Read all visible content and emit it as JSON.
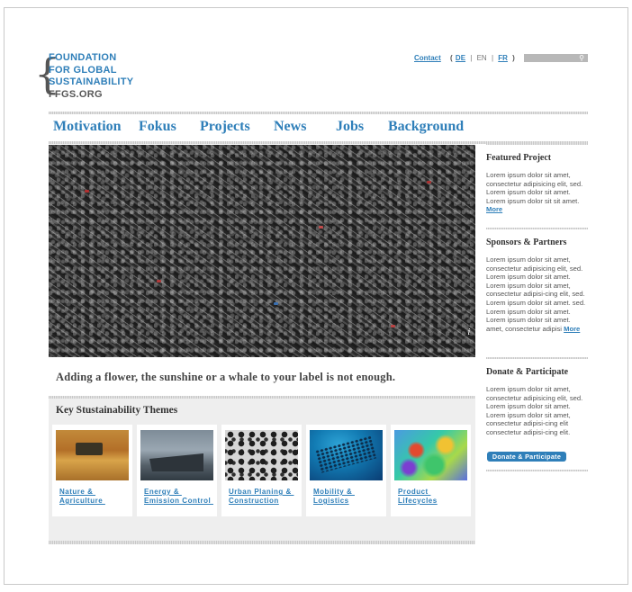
{
  "logo": {
    "line1": "FOUNDATION",
    "line2": "FOR GLOBAL",
    "line3": "SUSTAINABILITY",
    "line4": "FFGS.ORG"
  },
  "utility": {
    "contact": "Contact",
    "paren_open": "(",
    "lang_de": "DE",
    "sep1": "|",
    "lang_en": "EN",
    "sep2": "|",
    "lang_fr": "FR",
    "paren_close": ")",
    "search_icon": "search-icon"
  },
  "nav": {
    "items": [
      "Motivation",
      "Fokus",
      "Projects",
      "News",
      "Jobs",
      "Background"
    ]
  },
  "hero": {
    "info_glyph": "i"
  },
  "tagline": "Adding a flower, the sunshine or a whale to your label is not enough.",
  "themes": {
    "title": "Key Stustainability Themes",
    "cards": [
      {
        "label": "Nature & \nAgriculture ",
        "image": "wheat-field-harvester"
      },
      {
        "label": "Energy & \nEmission Control ",
        "image": "cargo-ship"
      },
      {
        "label": "Urban Planing & \nConstruction",
        "image": "leopard-pattern"
      },
      {
        "label": "Mobility & \nLogistics",
        "image": "fish-school"
      },
      {
        "label": "Product \nLifecycles",
        "image": "thermal-map"
      }
    ]
  },
  "sidebar": {
    "featured": {
      "title": "Featured Project",
      "body": "Lorem ipsum dolor sit amet, consectetur adipisicing elit, sed. Lorem ipsum dolor sit amet. Lorem ipsum dolor sit sit amet.",
      "more": "More"
    },
    "sponsors": {
      "title": "Sponsors & Partners",
      "body": "Lorem ipsum dolor sit amet, consectetur adipisicing elit, sed. Lorem ipsum dolor sit amet. Lorem ipsum dolor sit amet, consectetur adipisi-cing elit, sed. Lorem ipsum dolor sit amet. sed. Lorem ipsum dolor sit amet. Lorem ipsum dolor sit amet. amet, consectetur adipisi",
      "more": "More"
    },
    "donate": {
      "title": "Donate & Participate",
      "body": "Lorem ipsum dolor sit amet, consectetur adipisicing elit, sed. Lorem ipsum dolor sit amet. Lorem ipsum dolor sit amet, consectetur adipisi-cing elit consectetur adipisi-cing elit.",
      "button": "Donate & Participate"
    }
  },
  "colors": {
    "accent": "#2f7fb9",
    "text": "#333333",
    "panel": "#eeeeee"
  }
}
